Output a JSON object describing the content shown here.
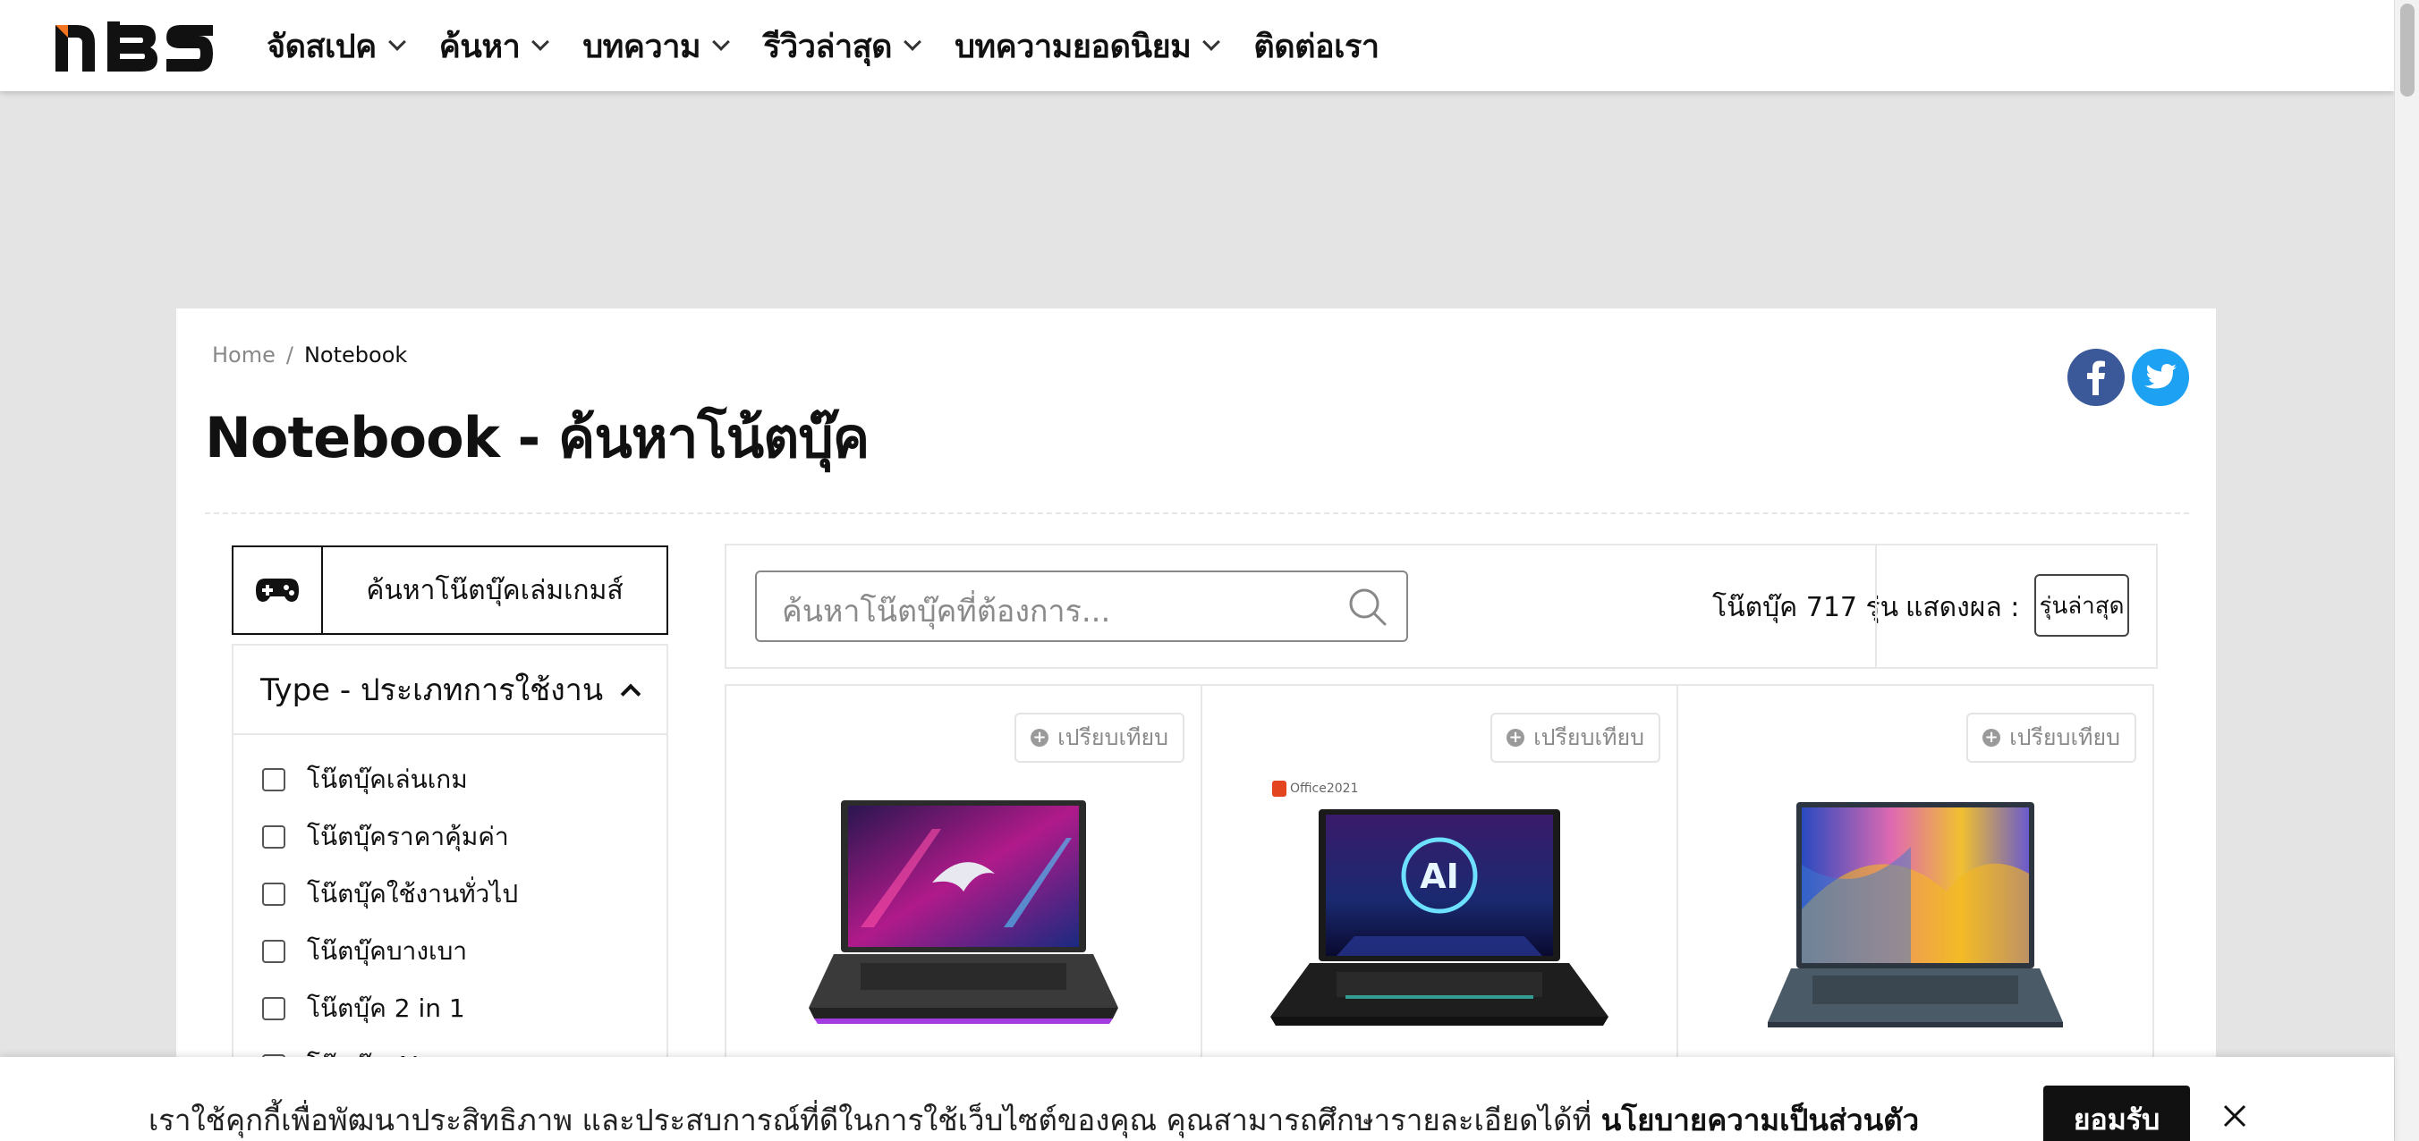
{
  "nav": {
    "items": [
      {
        "label": "จัดสเปค",
        "has_dropdown": true
      },
      {
        "label": "ค้นหา",
        "has_dropdown": true
      },
      {
        "label": "บทความ",
        "has_dropdown": true
      },
      {
        "label": "รีวิวล่าสุด",
        "has_dropdown": true
      },
      {
        "label": "บทความยอดนิยม",
        "has_dropdown": true
      },
      {
        "label": "ติดต่อเรา",
        "has_dropdown": false
      }
    ]
  },
  "breadcrumb": {
    "home": "Home",
    "separator": "/",
    "current": "Notebook"
  },
  "page": {
    "title": "Notebook - ค้นหาโน้ตบุ๊ค"
  },
  "sidebar": {
    "game_button_label": "ค้นหาโน๊ตบุ๊คเล่มเกมส์",
    "filter_title": "Type - ประเภทการใช้งาน",
    "options": [
      {
        "label": "โน๊ตบุ๊คเล่นเกม",
        "checked": false
      },
      {
        "label": "โน๊ตบุ๊คราคาคุ้มค่า",
        "checked": false
      },
      {
        "label": "โน๊ตบุ๊คใช้งานทั่วไป",
        "checked": false
      },
      {
        "label": "โน๊ตบุ๊คบางเบา",
        "checked": false
      },
      {
        "label": "โน๊ตบุ๊ค 2 in 1",
        "checked": false
      },
      {
        "label": "โน๊ตบุ๊ค AI",
        "checked": false
      }
    ]
  },
  "toolbar": {
    "search_placeholder": "ค้นหาโน๊ตบุ๊คที่ต้องการ...",
    "count_text": "โน๊ตบุ๊ค 717 รุ่น",
    "sort_label": "แสดงผล :",
    "sort_value": "รุ่นล่าสุด"
  },
  "products": [
    {
      "compare_label": "เปรียบเทียบ"
    },
    {
      "compare_label": "เปรียบเทียบ",
      "badge": "Office2021"
    },
    {
      "compare_label": "เปรียบเทียบ"
    }
  ],
  "cookie": {
    "text": "เราใช้คุกกี้เพื่อพัฒนาประสิทธิภาพ และประสบการณ์ที่ดีในการใช้เว็บไซต์ของคุณ คุณสามารถศึกษารายละเอียดได้ที่ ",
    "link": "นโยบายความเป็นส่วนตัว",
    "accept": "ยอมรับ"
  },
  "colors": {
    "facebook": "#3b5998",
    "twitter": "#1da1f2",
    "logo_accent": "#f47521"
  }
}
